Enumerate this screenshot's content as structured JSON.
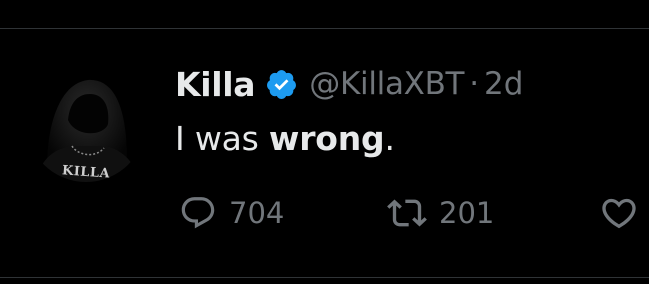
{
  "user": {
    "display_name": "Killa",
    "handle": "@KillaXBT",
    "separator": "·",
    "time": "2d",
    "verified": true,
    "verified_color": "#1d9bf0",
    "avatar_text": "KILLA"
  },
  "tweet": {
    "text_before": "I was ",
    "text_bold": "wrong",
    "text_after": "."
  },
  "actions": {
    "replies": "704",
    "retweets": "201",
    "reply_icon": "reply-icon",
    "retweet_icon": "retweet-icon",
    "like_icon": "heart-icon"
  },
  "colors": {
    "background": "#000000",
    "text": "#e7e9ea",
    "secondary": "#71767b",
    "border": "#2f3336"
  }
}
